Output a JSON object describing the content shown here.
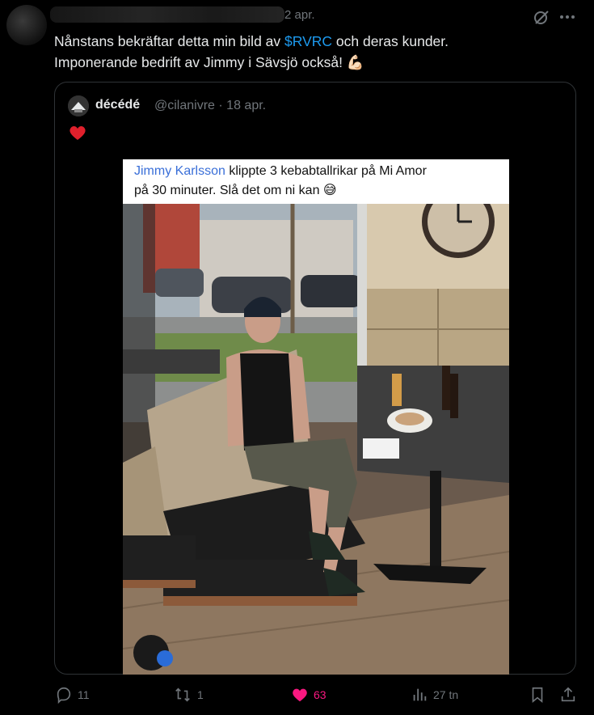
{
  "tweet": {
    "date": "2 apr.",
    "text_part1": "Nånstans bekräftar detta min bild av ",
    "cashtag": "$RVRC",
    "text_part2": " och deras kunder.",
    "text_line2": "Imponerande bedrift av Jimmy i Sävsjö också! 💪🏻"
  },
  "quote": {
    "name": "décédé",
    "handle": "@cilanivre",
    "separator": "·",
    "date": "18 apr.",
    "reaction": "❤️"
  },
  "embedded_post": {
    "caption_link": "Jimmy Karlsson",
    "caption_line1": " klippte 3 kebabtallrikar på Mi Amor",
    "caption_line2": "på 30 minuter. Slå det om ni kan 😅"
  },
  "actions": {
    "replies": "11",
    "reposts": "1",
    "likes": "63",
    "views": "27 tn"
  },
  "colors": {
    "background": "#000000",
    "text": "#e7e9ea",
    "muted": "#71767b",
    "accent": "#1d9bf0",
    "like": "#f91880"
  }
}
